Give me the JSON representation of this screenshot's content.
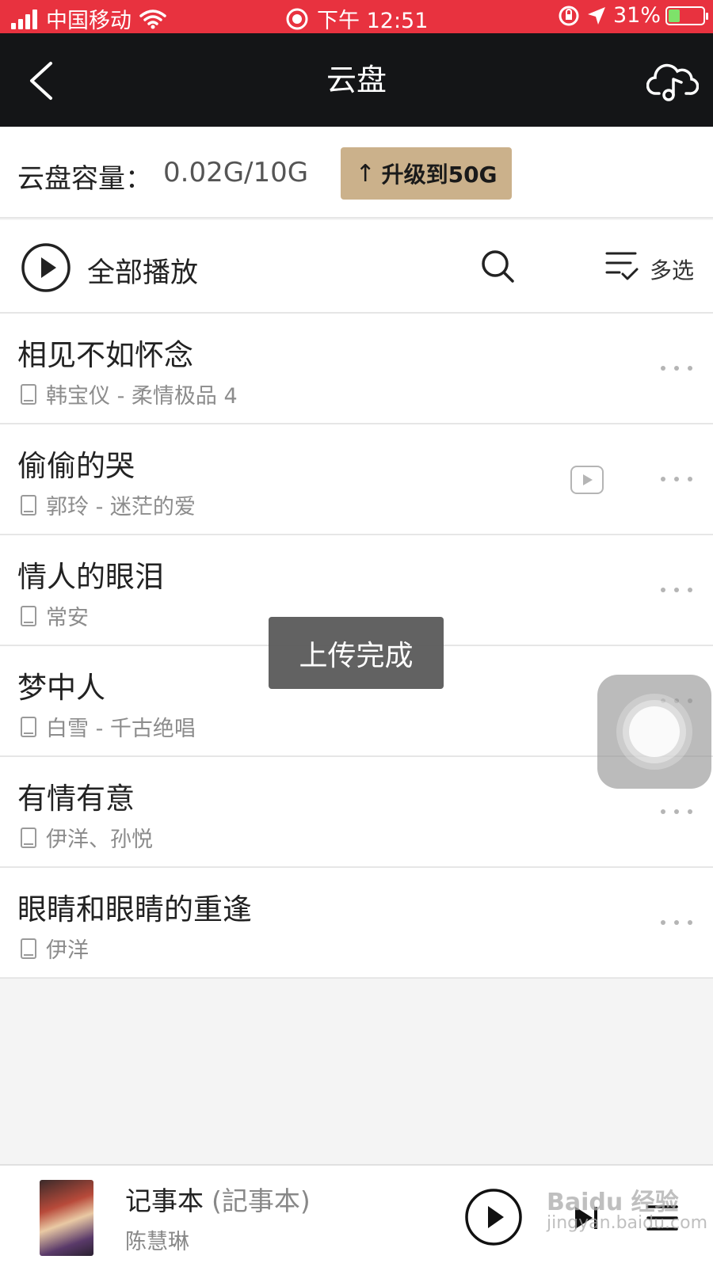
{
  "status_bar": {
    "carrier": "中国移动",
    "time": "下午 12:51",
    "battery": "31%",
    "battery_level": 0.31,
    "icons": [
      "signal-icon",
      "wifi-icon",
      "record-icon",
      "orientation-lock-icon",
      "location-icon",
      "battery-icon"
    ]
  },
  "nav": {
    "title": "云盘",
    "back_icon": "chevron-left-icon",
    "cloud_icon": "cloud-music-icon"
  },
  "capacity": {
    "label": "云盘容量：",
    "value": "0.02G/10G",
    "upgrade_arrow": "↑",
    "upgrade_label": "升级到50G",
    "upgrade_color": "#cbb18b"
  },
  "toolbar": {
    "play_all": "全部播放",
    "multi_select": "多选"
  },
  "songs": [
    {
      "title": "相见不如怀念",
      "subtitle": "韩宝仪 - 柔情极品 4",
      "has_mv": false
    },
    {
      "title": "偷偷的哭",
      "subtitle": "郭玲 - 迷茫的爱",
      "has_mv": true
    },
    {
      "title": "情人的眼泪",
      "subtitle": "常安",
      "has_mv": false
    },
    {
      "title": "梦中人",
      "subtitle": "白雪 - 千古绝唱",
      "has_mv": false
    },
    {
      "title": "有情有意",
      "subtitle": "伊洋、孙悦",
      "has_mv": false
    },
    {
      "title": "眼睛和眼睛的重逢",
      "subtitle": "伊洋",
      "has_mv": false
    }
  ],
  "toast": "上传完成",
  "player": {
    "title": "记事本",
    "alt_title": "(記事本)",
    "artist": "陈慧琳"
  },
  "watermark": {
    "main": "Baidu 经验",
    "url": "jingyan.baidu.com"
  },
  "colors": {
    "status_bar": "#e8323f",
    "nav_bar": "#141517",
    "accent_gold": "#cbb18b"
  }
}
